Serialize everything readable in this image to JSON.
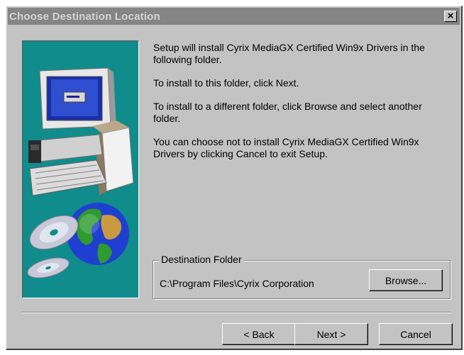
{
  "window": {
    "title": "Choose Destination Location",
    "close_label": "×"
  },
  "body": {
    "paragraphs": [
      "Setup will install Cyrix MediaGX Certified Win9x Drivers in the following folder.",
      "To install to this folder, click Next.",
      "To install to a different folder, click Browse and select another folder.",
      "You can choose not to install Cyrix MediaGX Certified Win9x Drivers by clicking Cancel to exit Setup."
    ]
  },
  "destination": {
    "group_label": "Destination Folder",
    "path": "C:\\Program Files\\Cyrix Corporation",
    "browse_label": "Browse..."
  },
  "buttons": {
    "back_label": "< Back",
    "next_label": "Next >",
    "cancel_label": "Cancel"
  },
  "colors": {
    "dialog_bg": "#c3c3c3",
    "titlebar_bg": "#858585",
    "picture_bg": "#108c8c"
  },
  "icons": [
    "computer-illustration",
    "cd-icon",
    "globe-icon",
    "box-icon"
  ]
}
